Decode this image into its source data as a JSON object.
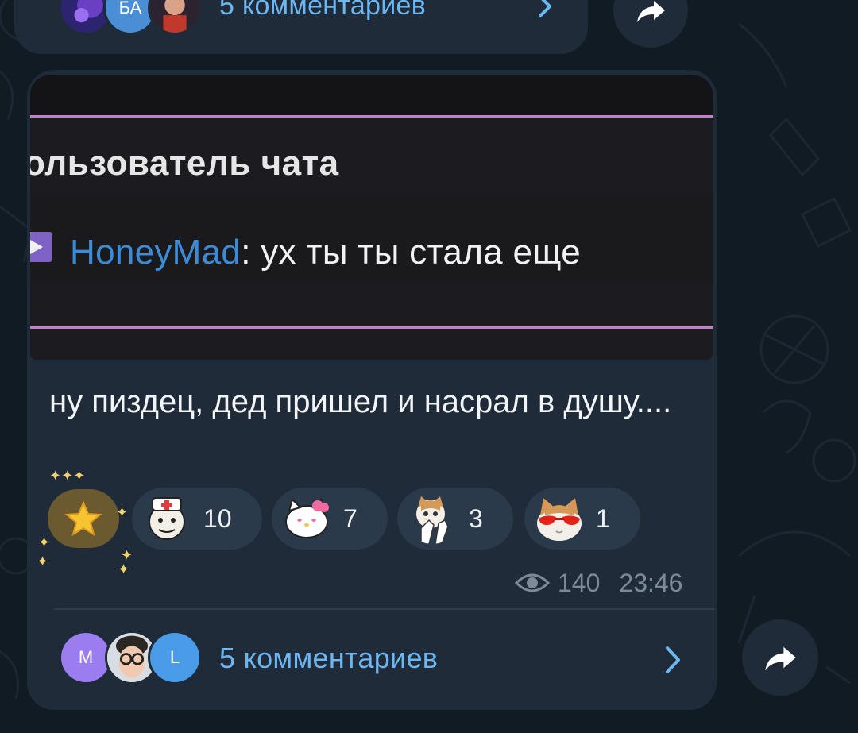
{
  "previous_message": {
    "avatar_letters": "БА",
    "comments_label": "5 комментариев"
  },
  "message": {
    "photo": {
      "title_text": "ользователь чата",
      "chat_username": "HoneyMad",
      "chat_text": ": ух ты ты стала еще"
    },
    "text": "ну пиздец, дед пришел и насрал в душу....",
    "reactions": [
      {
        "sticker": "star-icon",
        "count": ""
      },
      {
        "sticker": "doctor-meme-sticker",
        "count": "10"
      },
      {
        "sticker": "hello-kitty-sticker",
        "count": "7"
      },
      {
        "sticker": "cat-praying-sticker",
        "count": "3"
      },
      {
        "sticker": "cat-sunglasses-sticker",
        "count": "1"
      }
    ],
    "views": "140",
    "time": "23:46",
    "comment_avatars": [
      "M",
      "",
      "L"
    ],
    "comments_label": "5 комментариев"
  },
  "colors": {
    "background": "#111b24",
    "bubble": "#1f2b38",
    "link": "#6cb7f2",
    "reaction_chip": "#2a3a4b"
  }
}
